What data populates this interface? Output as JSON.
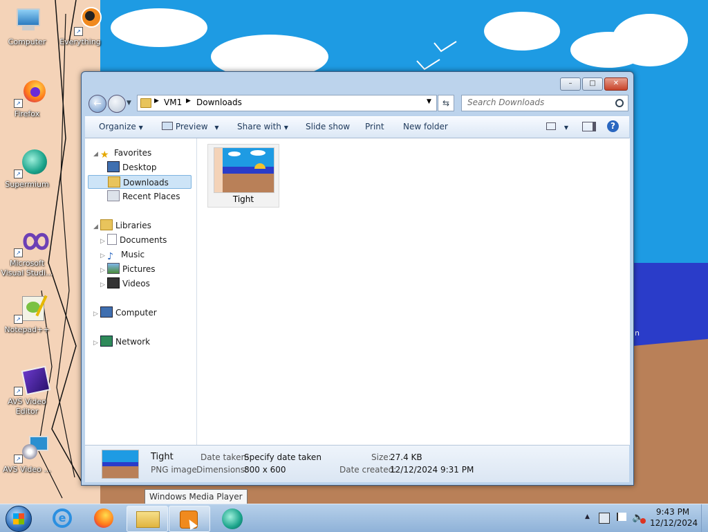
{
  "desktop": {
    "icons": [
      {
        "label": "Computer",
        "icon": "computer-icon"
      },
      {
        "label": "Everything",
        "icon": "everything-icon"
      },
      {
        "label": "Firefox",
        "icon": "firefox-icon"
      },
      {
        "label": "Supermium",
        "icon": "supermium-icon"
      },
      {
        "label": "Microsoft Visual Studi...",
        "icon": "visual-studio-icon"
      },
      {
        "label": "Notepad++",
        "icon": "notepad-plus-plus-icon"
      },
      {
        "label": "AVS Video Editor",
        "icon": "avs-video-editor-icon"
      },
      {
        "label": "AVS Video ...",
        "icon": "avs-video-converter-icon"
      }
    ],
    "partial_text": "in",
    "colors": {
      "sky": "#1e9be3",
      "sea": "#2a3cc9",
      "sand": "#b98058",
      "wall": "#f4d3b8"
    }
  },
  "window": {
    "controls": {
      "minimize": "–",
      "maximize": "□",
      "close": "✕"
    },
    "address": {
      "crumbs": [
        "VM1",
        "Downloads"
      ]
    },
    "search": {
      "placeholder": "Search Downloads"
    },
    "toolbar": {
      "organize": "Organize",
      "preview": "Preview",
      "share_with": "Share with",
      "slide_show": "Slide show",
      "print": "Print",
      "new_folder": "New folder"
    },
    "nav": {
      "favorites": "Favorites",
      "desktop": "Desktop",
      "downloads": "Downloads",
      "recent_places": "Recent Places",
      "libraries": "Libraries",
      "documents": "Documents",
      "music": "Music",
      "pictures": "Pictures",
      "videos": "Videos",
      "computer": "Computer",
      "network": "Network"
    },
    "files": [
      {
        "name": "Tight",
        "icon": "image-thumbnail-icon"
      }
    ],
    "details": {
      "name": "Tight",
      "type": "PNG image",
      "date_taken_label": "Date taken:",
      "date_taken_value": "Specify date taken",
      "dimensions_label": "Dimensions:",
      "dimensions_value": "800 x 600",
      "size_label": "Size:",
      "size_value": "27.4 KB",
      "date_created_label": "Date created:",
      "date_created_value": "12/12/2024 9:31 PM"
    }
  },
  "tooltip": "Windows Media Player",
  "taskbar": {
    "buttons": [
      "start-orb",
      "internet-explorer",
      "firefox",
      "windows-explorer",
      "windows-media-player",
      "supermium"
    ],
    "clock_time": "9:43 PM",
    "clock_date": "12/12/2024",
    "tray_show_hidden": "▲"
  }
}
